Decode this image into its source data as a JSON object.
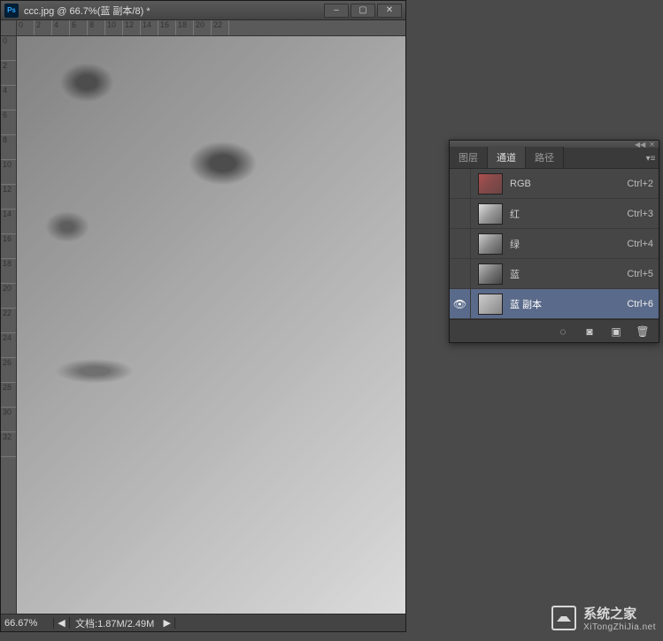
{
  "doc": {
    "ps_icon_text": "Ps",
    "title": "ccc.jpg @ 66.7%(蓝 副本/8) *",
    "zoom": "66.67%",
    "info_label": "文档:",
    "info_value": "1.87M/2.49M",
    "ruler_h": [
      "0",
      "2",
      "4",
      "6",
      "8",
      "10",
      "12",
      "14",
      "16",
      "18",
      "20",
      "22"
    ],
    "ruler_v": [
      "0",
      "2",
      "4",
      "6",
      "8",
      "10",
      "12",
      "14",
      "16",
      "18",
      "20",
      "22",
      "24",
      "26",
      "28",
      "30",
      "32"
    ]
  },
  "panel": {
    "tabs": {
      "layers": "图层",
      "channels": "通道",
      "paths": "路径"
    },
    "active_tab": "channels",
    "channels": [
      {
        "id": "rgb",
        "name": "RGB",
        "shortcut": "Ctrl+2",
        "thumb": "rgb",
        "visible": false,
        "selected": false
      },
      {
        "id": "red",
        "name": "红",
        "shortcut": "Ctrl+3",
        "thumb": "red",
        "visible": false,
        "selected": false
      },
      {
        "id": "green",
        "name": "绿",
        "shortcut": "Ctrl+4",
        "thumb": "green",
        "visible": false,
        "selected": false
      },
      {
        "id": "blue",
        "name": "蓝",
        "shortcut": "Ctrl+5",
        "thumb": "blue",
        "visible": false,
        "selected": false
      },
      {
        "id": "bluecopy",
        "name": "蓝 副本",
        "shortcut": "Ctrl+6",
        "thumb": "bluecopy",
        "visible": true,
        "selected": true
      }
    ],
    "footer_icons": {
      "load_selection": "load-selection-icon",
      "save_selection": "save-selection-icon",
      "new_channel": "new-channel-icon",
      "delete_channel": "delete-channel-icon"
    }
  },
  "watermark": {
    "cn": "系统之家",
    "en": "XiTongZhiJia.net"
  }
}
